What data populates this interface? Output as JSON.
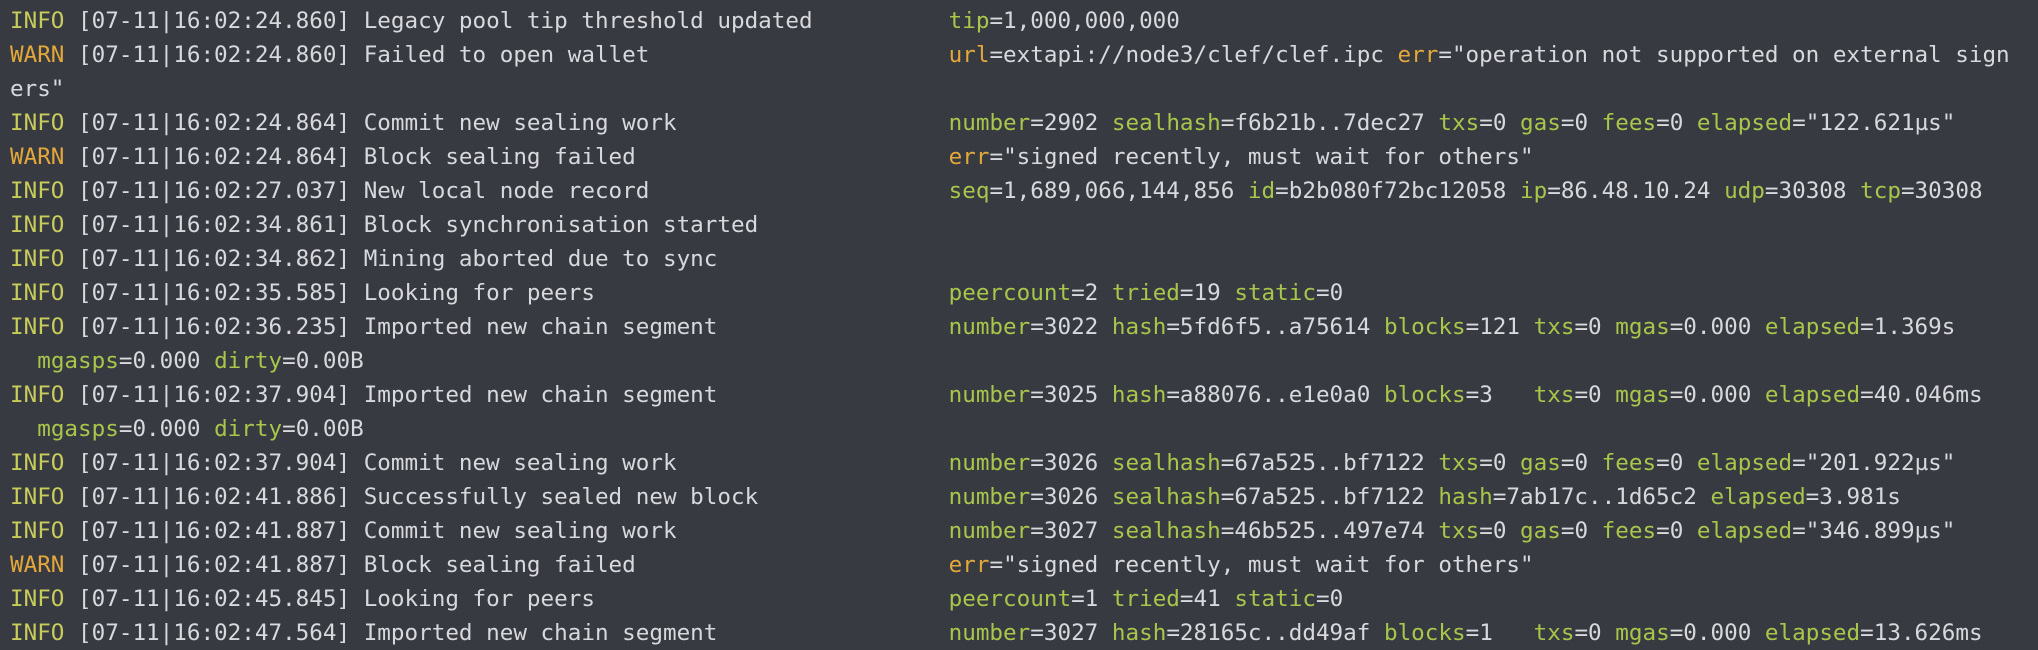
{
  "colors": {
    "background": "#383a42",
    "text": "#d7d9dd",
    "info_level": "#c8cc5a",
    "warn_level": "#e2a83a",
    "info_key": "#a7c64a",
    "warn_key": "#e2a83a"
  },
  "lines": [
    {
      "level": "INFO",
      "ts": "[07-11|16:02:24.860]",
      "msg": "Legacy pool tip threshold updated",
      "fields": [
        {
          "k": "tip",
          "v": "1,000,000,000",
          "c": "info"
        }
      ]
    },
    {
      "level": "WARN",
      "ts": "[07-11|16:02:24.860]",
      "msg": "Failed to open wallet",
      "fields": [
        {
          "k": "url",
          "v": "extapi://node3/clef/clef.ipc",
          "c": "warn"
        },
        {
          "k": "err",
          "v": "\"operation not supported on external sign",
          "c": "warn"
        }
      ]
    },
    {
      "cont": "ers\""
    },
    {
      "level": "INFO",
      "ts": "[07-11|16:02:24.864]",
      "msg": "Commit new sealing work",
      "fields": [
        {
          "k": "number",
          "v": "2902",
          "c": "info"
        },
        {
          "k": "sealhash",
          "v": "f6b21b..7dec27",
          "c": "info"
        },
        {
          "k": "txs",
          "v": "0",
          "c": "info"
        },
        {
          "k": "gas",
          "v": "0",
          "c": "info"
        },
        {
          "k": "fees",
          "v": "0",
          "c": "info"
        },
        {
          "k": "elapsed",
          "v": "\"122.621µs\"",
          "c": "info"
        }
      ]
    },
    {
      "level": "WARN",
      "ts": "[07-11|16:02:24.864]",
      "msg": "Block sealing failed",
      "fields": [
        {
          "k": "err",
          "v": "\"signed recently, must wait for others\"",
          "c": "warn"
        }
      ]
    },
    {
      "level": "INFO",
      "ts": "[07-11|16:02:27.037]",
      "msg": "New local node record",
      "fields": [
        {
          "k": "seq",
          "v": "1,689,066,144,856",
          "c": "info"
        },
        {
          "k": "id",
          "v": "b2b080f72bc12058",
          "c": "info"
        },
        {
          "k": "ip",
          "v": "86.48.10.24",
          "c": "info"
        },
        {
          "k": "udp",
          "v": "30308",
          "c": "info"
        },
        {
          "k": "tcp",
          "v": "30308",
          "c": "info"
        }
      ]
    },
    {
      "level": "INFO",
      "ts": "[07-11|16:02:34.861]",
      "msg": "Block synchronisation started",
      "fields": []
    },
    {
      "level": "INFO",
      "ts": "[07-11|16:02:34.862]",
      "msg": "Mining aborted due to sync",
      "fields": []
    },
    {
      "level": "INFO",
      "ts": "[07-11|16:02:35.585]",
      "msg": "Looking for peers",
      "fields": [
        {
          "k": "peercount",
          "v": "2",
          "c": "info"
        },
        {
          "k": "tried",
          "v": "19",
          "c": "info"
        },
        {
          "k": "static",
          "v": "0",
          "c": "info"
        }
      ]
    },
    {
      "level": "INFO",
      "ts": "[07-11|16:02:36.235]",
      "msg": "Imported new chain segment",
      "fields": [
        {
          "k": "number",
          "v": "3022",
          "c": "info"
        },
        {
          "k": "hash",
          "v": "5fd6f5..a75614",
          "c": "info"
        },
        {
          "k": "blocks",
          "v": "121",
          "c": "info"
        },
        {
          "k": "txs",
          "v": "0",
          "c": "info"
        },
        {
          "k": "mgas",
          "v": "0.000",
          "c": "info"
        },
        {
          "k": "elapsed",
          "v": "1.369s",
          "c": "info"
        }
      ]
    },
    {
      "contfields": [
        {
          "k": "mgasps",
          "v": "0.000",
          "c": "info"
        },
        {
          "k": "dirty",
          "v": "0.00B",
          "c": "info"
        }
      ]
    },
    {
      "level": "INFO",
      "ts": "[07-11|16:02:37.904]",
      "msg": "Imported new chain segment",
      "fields": [
        {
          "k": "number",
          "v": "3025",
          "c": "info"
        },
        {
          "k": "hash",
          "v": "a88076..e1e0a0",
          "c": "info"
        },
        {
          "k": "blocks",
          "v": "3  ",
          "c": "info"
        },
        {
          "k": "txs",
          "v": "0",
          "c": "info"
        },
        {
          "k": "mgas",
          "v": "0.000",
          "c": "info"
        },
        {
          "k": "elapsed",
          "v": "40.046ms",
          "c": "info"
        }
      ]
    },
    {
      "contfields": [
        {
          "k": "mgasps",
          "v": "0.000",
          "c": "info"
        },
        {
          "k": "dirty",
          "v": "0.00B",
          "c": "info"
        }
      ]
    },
    {
      "level": "INFO",
      "ts": "[07-11|16:02:37.904]",
      "msg": "Commit new sealing work",
      "fields": [
        {
          "k": "number",
          "v": "3026",
          "c": "info"
        },
        {
          "k": "sealhash",
          "v": "67a525..bf7122",
          "c": "info"
        },
        {
          "k": "txs",
          "v": "0",
          "c": "info"
        },
        {
          "k": "gas",
          "v": "0",
          "c": "info"
        },
        {
          "k": "fees",
          "v": "0",
          "c": "info"
        },
        {
          "k": "elapsed",
          "v": "\"201.922µs\"",
          "c": "info"
        }
      ]
    },
    {
      "level": "INFO",
      "ts": "[07-11|16:02:41.886]",
      "msg": "Successfully sealed new block",
      "fields": [
        {
          "k": "number",
          "v": "3026",
          "c": "info"
        },
        {
          "k": "sealhash",
          "v": "67a525..bf7122",
          "c": "info"
        },
        {
          "k": "hash",
          "v": "7ab17c..1d65c2",
          "c": "info"
        },
        {
          "k": "elapsed",
          "v": "3.981s",
          "c": "info"
        }
      ]
    },
    {
      "level": "INFO",
      "ts": "[07-11|16:02:41.887]",
      "msg": "Commit new sealing work",
      "fields": [
        {
          "k": "number",
          "v": "3027",
          "c": "info"
        },
        {
          "k": "sealhash",
          "v": "46b525..497e74",
          "c": "info"
        },
        {
          "k": "txs",
          "v": "0",
          "c": "info"
        },
        {
          "k": "gas",
          "v": "0",
          "c": "info"
        },
        {
          "k": "fees",
          "v": "0",
          "c": "info"
        },
        {
          "k": "elapsed",
          "v": "\"346.899µs\"",
          "c": "info"
        }
      ]
    },
    {
      "level": "WARN",
      "ts": "[07-11|16:02:41.887]",
      "msg": "Block sealing failed",
      "fields": [
        {
          "k": "err",
          "v": "\"signed recently, must wait for others\"",
          "c": "warn"
        }
      ]
    },
    {
      "level": "INFO",
      "ts": "[07-11|16:02:45.845]",
      "msg": "Looking for peers",
      "fields": [
        {
          "k": "peercount",
          "v": "1",
          "c": "info"
        },
        {
          "k": "tried",
          "v": "41",
          "c": "info"
        },
        {
          "k": "static",
          "v": "0",
          "c": "info"
        }
      ]
    },
    {
      "level": "INFO",
      "ts": "[07-11|16:02:47.564]",
      "msg": "Imported new chain segment",
      "fields": [
        {
          "k": "number",
          "v": "3027",
          "c": "info"
        },
        {
          "k": "hash",
          "v": "28165c..dd49af",
          "c": "info"
        },
        {
          "k": "blocks",
          "v": "1  ",
          "c": "info"
        },
        {
          "k": "txs",
          "v": "0",
          "c": "info"
        },
        {
          "k": "mgas",
          "v": "0.000",
          "c": "info"
        },
        {
          "k": "elapsed",
          "v": "13.626ms",
          "c": "info"
        }
      ]
    }
  ]
}
